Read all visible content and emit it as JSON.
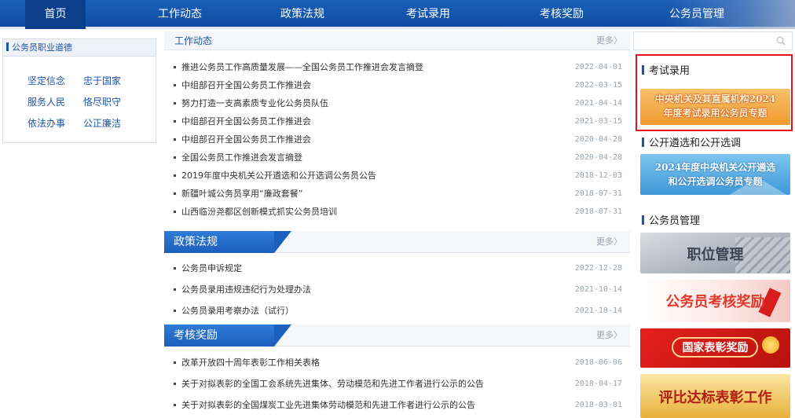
{
  "nav": {
    "items": [
      "首页",
      "工作动态",
      "政策法规",
      "考试录用",
      "考核奖励",
      "公务员管理"
    ],
    "active": "首页"
  },
  "sidebar": {
    "title": "公务员职业道德",
    "links": [
      "坚定信念",
      "忠于国家",
      "服务人民",
      "恪尽职守",
      "依法办事",
      "公正廉洁"
    ]
  },
  "work_news": {
    "title": "工作动态",
    "more": "更多〉",
    "items": [
      {
        "title": "推进公务员工作高质量发展——全国公务员工作推进会发言摘登",
        "date": "2022-04-01"
      },
      {
        "title": "中组部召开全国公务员工作推进会",
        "date": "2022-03-15"
      },
      {
        "title": "努力打造一支高素质专业化公务员队伍",
        "date": "2021-04-14"
      },
      {
        "title": "中组部召开全国公务员工作推进会",
        "date": "2021-03-15"
      },
      {
        "title": "中组部召开全国公务员工作推进会",
        "date": "2020-04-28"
      },
      {
        "title": "全国公务员工作推进会发言摘登",
        "date": "2020-04-28"
      },
      {
        "title": "2019年度中央机关公开遴选和公开选调公务员公告",
        "date": "2018-12-03"
      },
      {
        "title": "新疆叶城公务员享用“廉政套餐”",
        "date": "2018-07-31"
      },
      {
        "title": "山西临汾尧都区创新模式抓实公务员培训",
        "date": "2018-07-31"
      }
    ]
  },
  "policy": {
    "title": "政策法规",
    "more": "更多〉",
    "items": [
      {
        "title": "公务员申诉规定",
        "date": "2022-12-28"
      },
      {
        "title": "公务员录用违规违纪行为处理办法",
        "date": "2021-10-14"
      },
      {
        "title": "公务员录用考察办法（试行）",
        "date": "2021-10-14"
      }
    ]
  },
  "rewards": {
    "title": "考核奖励",
    "more": "更多〉",
    "items": [
      {
        "title": "改革开放四十周年表彰工作相关表格",
        "date": "2018-06-06"
      },
      {
        "title": "关于对拟表彰的全国工会系统先进集体、劳动模范和先进工作者进行公示的公告",
        "date": "2018-04-17"
      },
      {
        "title": "关于对拟表彰的全国煤炭工业先进集体劳动模范和先进工作者进行公示的公告",
        "date": "2018-03-01"
      }
    ]
  },
  "right": {
    "search_placeholder": "",
    "exam_title": "考试录用",
    "exam_banner": [
      "中央机关及其直属机构2024",
      "年度考试录用公务员专题"
    ],
    "select_title": "公开遴选和公开选调",
    "select_banner": [
      "2024年度中央机关公开遴选",
      "和公开选调公务员专题"
    ],
    "manage_title": "公务员管理",
    "manage_banners": [
      "职位管理",
      "公务员考核奖励",
      "国家表彰奖励",
      "评比达标表彰工作"
    ]
  },
  "colors": {
    "nav_blue": "#1a5fb8",
    "link_blue": "#1c54a8",
    "highlight_red": "#e1151a"
  }
}
